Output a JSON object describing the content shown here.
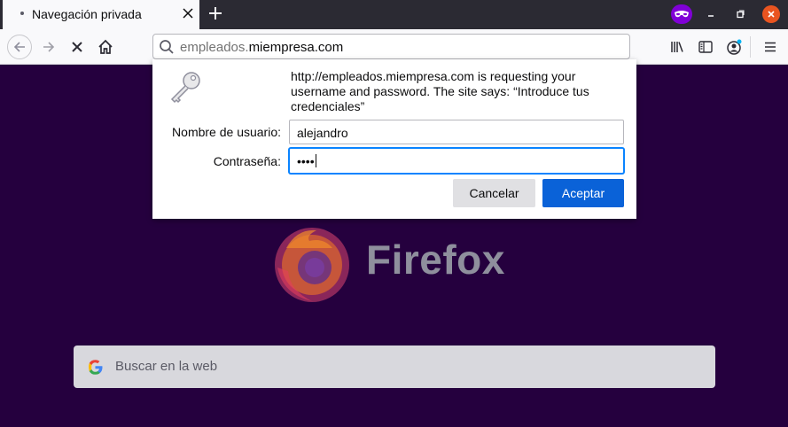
{
  "tab": {
    "title": "Navegación privada"
  },
  "url": {
    "prefix": "empleados.",
    "domain": "miempresa.com"
  },
  "dialog": {
    "message": "http://empleados.miempresa.com is requesting your username and password. The site says: “Introduce tus credenciales”",
    "username_label": "Nombre de usuario:",
    "username_value": "alejandro",
    "password_label": "Contraseña:",
    "password_mask": "••••",
    "cancel_label": "Cancelar",
    "accept_label": "Aceptar"
  },
  "page": {
    "brand": "Firefox",
    "search_placeholder": "Buscar en la web"
  },
  "icons": {
    "tab_close": "close-icon",
    "new_tab": "plus-icon",
    "private": "private-mask-icon",
    "back": "back-arrow-icon",
    "forward": "forward-arrow-icon",
    "stop": "stop-icon",
    "home": "home-icon",
    "search": "search-icon",
    "library": "library-icon",
    "sidebar": "sidebar-icon",
    "account": "account-icon",
    "menu": "hamburger-menu-icon",
    "key": "key-icon",
    "google": "google-icon"
  },
  "colors": {
    "accent": "#0a62d8",
    "page_bg": "#25003e",
    "private": "#8000d7",
    "close": "#e95420"
  }
}
